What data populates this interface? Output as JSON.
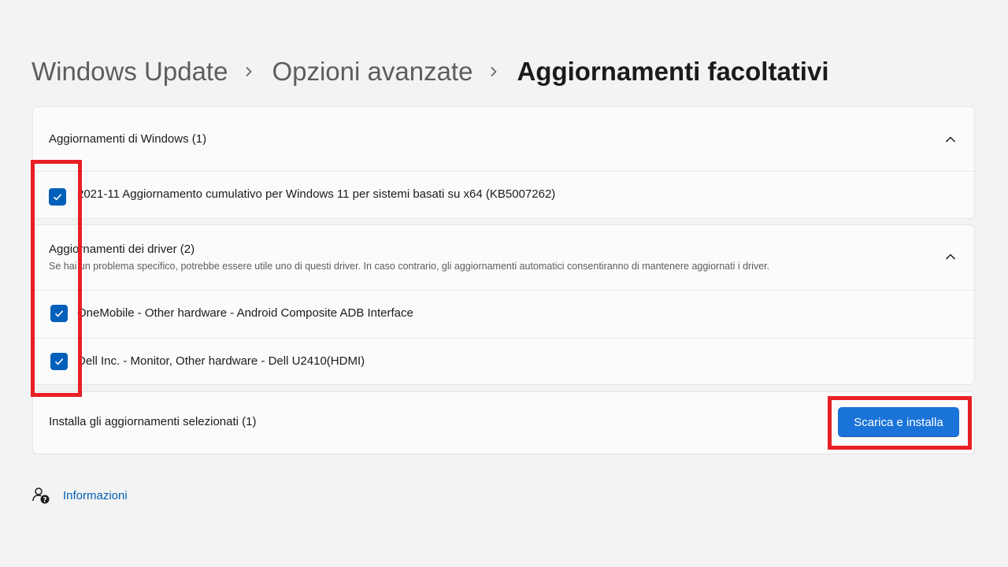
{
  "breadcrumb": {
    "items": [
      "Windows Update",
      "Opzioni avanzate"
    ],
    "current": "Aggiornamenti facoltativi"
  },
  "windows_updates": {
    "title": "Aggiornamenti di Windows (1)",
    "expanded": true,
    "items": [
      {
        "label": "2021-11 Aggiornamento cumulativo per Windows 11 per sistemi basati su x64 (KB5007262)",
        "checked": true
      }
    ]
  },
  "driver_updates": {
    "title": "Aggiornamenti dei driver (2)",
    "subtitle": "Se hai un problema specifico, potrebbe essere utile uno di questi driver. In caso contrario, gli aggiornamenti automatici consentiranno di mantenere aggiornati i driver.",
    "expanded": true,
    "items": [
      {
        "label": "OneMobile - Other hardware - Android Composite ADB Interface",
        "checked": true
      },
      {
        "label": "Dell Inc. - Monitor, Other hardware - Dell U2410(HDMI)",
        "checked": true
      }
    ]
  },
  "install": {
    "label": "Installa gli aggiornamenti selezionati (1)",
    "button_label": "Scarica e installa"
  },
  "info": {
    "link_label": "Informazioni",
    "icon": "help-person-icon"
  },
  "colors": {
    "accent": "#005fb8",
    "button": "#1a73d9",
    "highlight": "#e81f24",
    "background": "#f3f3f3"
  }
}
